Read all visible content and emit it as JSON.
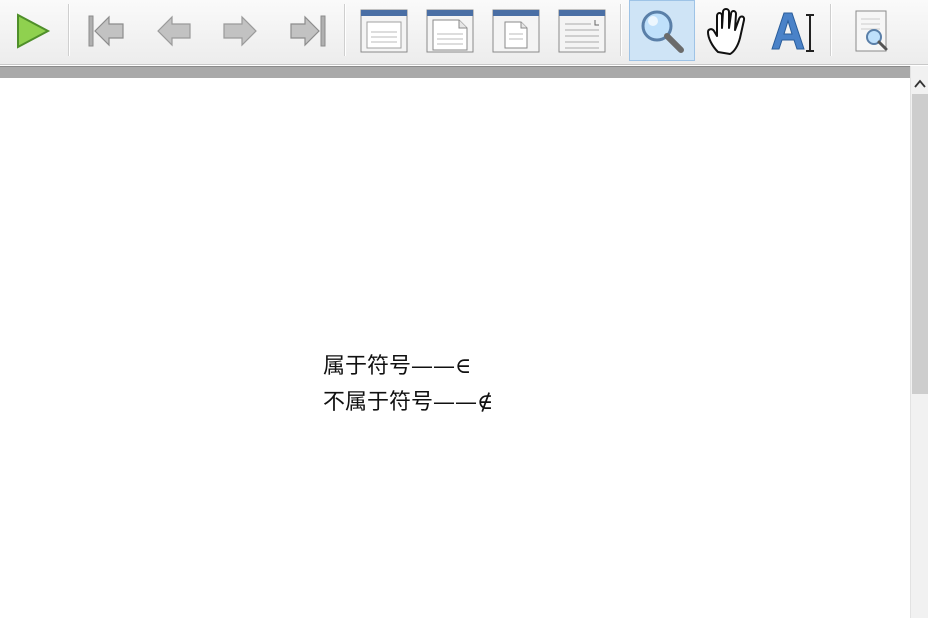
{
  "toolbar": {
    "buttons": [
      {
        "name": "play-icon",
        "label": "Play"
      },
      {
        "name": "first-page-icon",
        "label": "First page"
      },
      {
        "name": "previous-page-icon",
        "label": "Previous page"
      },
      {
        "name": "next-page-icon",
        "label": "Next page"
      },
      {
        "name": "last-page-icon",
        "label": "Last page"
      },
      {
        "name": "single-page-view-icon",
        "label": "Single page"
      },
      {
        "name": "facing-pages-view-icon",
        "label": "Facing pages"
      },
      {
        "name": "continuous-view-icon",
        "label": "Continuous"
      },
      {
        "name": "fit-width-view-icon",
        "label": "Fit width"
      },
      {
        "name": "zoom-tool-icon",
        "label": "Zoom tool",
        "active": true
      },
      {
        "name": "hand-tool-icon",
        "label": "Pan tool"
      },
      {
        "name": "text-select-tool-icon",
        "label": "Select text"
      },
      {
        "name": "find-in-page-icon",
        "label": "Find"
      }
    ],
    "colors": {
      "play": "#7ac143",
      "nav_disabled": "#a8a8a8",
      "doc_header": "#4a6fa5",
      "zoom_lens": "#5a9ad5",
      "text_tool": "#3d7cc9",
      "active_bg": "#cfe4f6"
    }
  },
  "document": {
    "lines": [
      {
        "text": "属于符号——∈"
      },
      {
        "text": "不属于符号——∉"
      }
    ]
  }
}
